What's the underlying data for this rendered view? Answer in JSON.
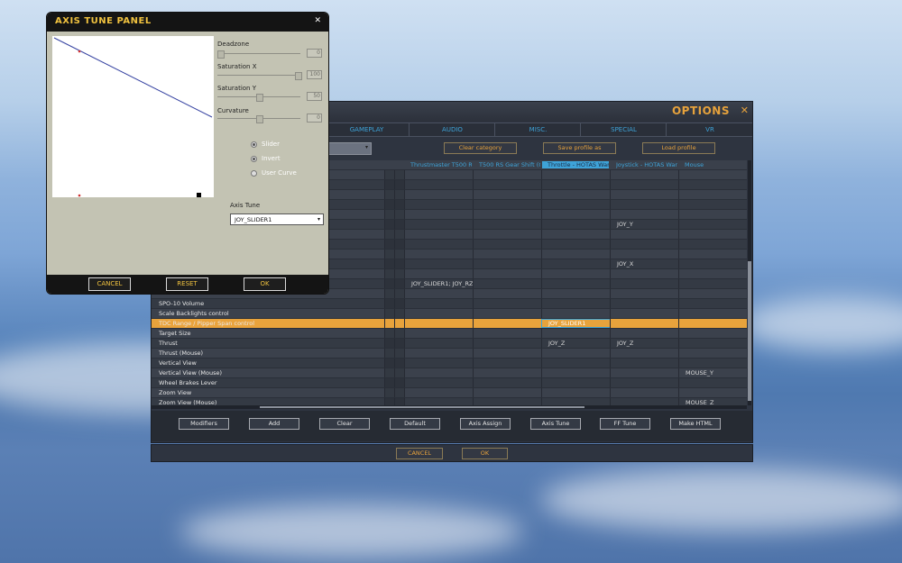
{
  "options": {
    "title": "OPTIONS",
    "close": "✕",
    "tabs": [
      "GAMEPLAY",
      "AUDIO",
      "MISC.",
      "SPECIAL",
      "VR"
    ],
    "toolbar": {
      "category_arrow": "▾",
      "clear_category": "Clear category",
      "save_profile_as": "Save profile as",
      "load_profile": "Load profile"
    },
    "columns": [
      "Thrustmaster T500 RS",
      "T500 RS Gear Shift (C",
      "Throttle - HOTAS Wart",
      "Joystick - HOTAS Wart",
      "Mouse"
    ],
    "rows": [
      {
        "name": "",
        "cells": [
          "",
          "",
          "",
          "",
          ""
        ]
      },
      {
        "name": "",
        "cells": [
          "",
          "",
          "",
          "",
          ""
        ]
      },
      {
        "name": "",
        "cells": [
          "",
          "",
          "",
          "",
          ""
        ]
      },
      {
        "name": "",
        "cells": [
          "",
          "",
          "",
          "",
          ""
        ]
      },
      {
        "name": "",
        "cells": [
          "",
          "",
          "",
          "",
          ""
        ]
      },
      {
        "name": "",
        "cells": [
          "",
          "",
          "",
          "JOY_Y",
          ""
        ]
      },
      {
        "name": "",
        "cells": [
          "",
          "",
          "",
          "",
          ""
        ]
      },
      {
        "name": "",
        "cells": [
          "",
          "",
          "",
          "",
          ""
        ]
      },
      {
        "name": "",
        "cells": [
          "",
          "",
          "",
          "",
          ""
        ]
      },
      {
        "name": "",
        "cells": [
          "",
          "",
          "",
          "JOY_X",
          ""
        ]
      },
      {
        "name": "",
        "cells": [
          "",
          "",
          "",
          "",
          ""
        ]
      },
      {
        "name": "",
        "cells": [
          "JOY_SLIDER1; JOY_RZ",
          "",
          "",
          "",
          ""
        ]
      },
      {
        "name": "",
        "cells": [
          "",
          "",
          "",
          "",
          ""
        ]
      },
      {
        "name": "SPO-10 Volume",
        "cells": [
          "",
          "",
          "",
          "",
          ""
        ]
      },
      {
        "name": "Scale Backlights control",
        "cells": [
          "",
          "",
          "",
          "",
          ""
        ]
      },
      {
        "name": "TDC Range / Pipper Span control",
        "cells": [
          "",
          "",
          "JOY_SLIDER1",
          "",
          ""
        ],
        "selected": true
      },
      {
        "name": "Target Size",
        "cells": [
          "",
          "",
          "",
          "",
          ""
        ]
      },
      {
        "name": "Thrust",
        "cells": [
          "",
          "",
          "JOY_Z",
          "JOY_Z",
          ""
        ]
      },
      {
        "name": "Thrust (Mouse)",
        "cells": [
          "",
          "",
          "",
          "",
          ""
        ]
      },
      {
        "name": "Vertical View",
        "cells": [
          "",
          "",
          "",
          "",
          ""
        ]
      },
      {
        "name": "Vertical View (Mouse)",
        "cells": [
          "",
          "",
          "",
          "",
          "MOUSE_Y"
        ]
      },
      {
        "name": "Wheel Brakes Lever",
        "cells": [
          "",
          "",
          "",
          "",
          ""
        ]
      },
      {
        "name": "Zoom View",
        "cells": [
          "",
          "",
          "",
          "",
          ""
        ]
      },
      {
        "name": "Zoom View (Mouse)",
        "cells": [
          "",
          "",
          "",
          "",
          "MOUSE_Z"
        ]
      }
    ],
    "buttons": [
      "Modifiers",
      "Add",
      "Clear",
      "Default",
      "Axis Assign",
      "Axis Tune",
      "FF Tune",
      "Make HTML"
    ],
    "footer": {
      "cancel": "CANCEL",
      "ok": "OK"
    }
  },
  "axis_panel": {
    "title": "AXIS TUNE PANEL",
    "close": "✕",
    "sliders": [
      {
        "label": "Deadzone",
        "value": "0",
        "level": 0.0
      },
      {
        "label": "Saturation X",
        "value": "100",
        "level": 1.0
      },
      {
        "label": "Saturation Y",
        "value": "50",
        "level": 0.5
      },
      {
        "label": "Curvature",
        "value": "0",
        "level": 0.5
      }
    ],
    "options": [
      {
        "label": "Slider",
        "checked": true
      },
      {
        "label": "Invert",
        "checked": true
      },
      {
        "label": "User Curve",
        "checked": false
      }
    ],
    "axis_tune_label": "Axis Tune",
    "axis_tune_value": "JOY_SLIDER1",
    "dropdown_arrow": "▾",
    "buttons": {
      "cancel": "CANCEL",
      "reset": "RESET",
      "ok": "OK"
    },
    "colors": {
      "curve": "#3340a0",
      "marker": "#d03030",
      "title": "#f0c23f"
    }
  },
  "colors": {
    "accent": "#e6a23c",
    "tab_text": "#3ea3d8",
    "selected_row": "#e8a33c"
  }
}
